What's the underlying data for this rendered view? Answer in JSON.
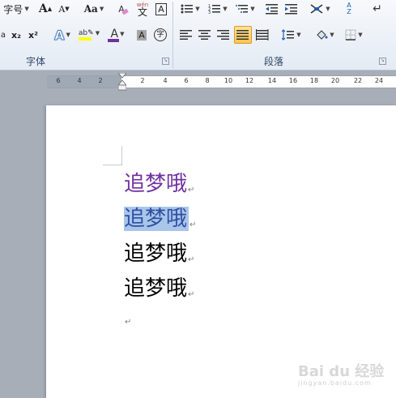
{
  "ribbon": {
    "font_size_label": "字号",
    "font_group_label": "字体",
    "paragraph_group_label": "段落",
    "change_case_label": "Aa",
    "grow_font_label": "A",
    "shrink_font_label": "A",
    "clear_format_label": "A",
    "phonetic_label": "wén",
    "phonetic_char": "文",
    "char_border_label": "A",
    "subscript_label": "x₂",
    "superscript_label": "x²",
    "text_effect_label": "A",
    "highlight_label": "ab",
    "font_color_label": "A",
    "char_shading_label": "A",
    "enclosed_char_label": "字",
    "sort_label": "A Z",
    "colors": {
      "font_color": "#c00000",
      "highlight": "#ffff00",
      "text_effect": "#4f81bd",
      "active_button": "#ffc64c"
    }
  },
  "ruler": {
    "ticks": [
      "6",
      "4",
      "2",
      "2",
      "4",
      "6",
      "8",
      "10",
      "12",
      "14",
      "16",
      "18",
      "20",
      "22",
      "24"
    ]
  },
  "document": {
    "lines": [
      {
        "text": "追梦哦",
        "color": "#7030a0",
        "selected": false
      },
      {
        "text": "追梦哦",
        "color": "#2e4fa3",
        "selected": true
      },
      {
        "text": "追梦哦",
        "color": "#000000",
        "selected": false
      },
      {
        "text": "追梦哦",
        "color": "#000000",
        "selected": false
      }
    ],
    "paragraph_mark": "↵"
  },
  "watermark": {
    "text": "Bai du 经验",
    "subtext": "jingyan.baidu.com"
  }
}
